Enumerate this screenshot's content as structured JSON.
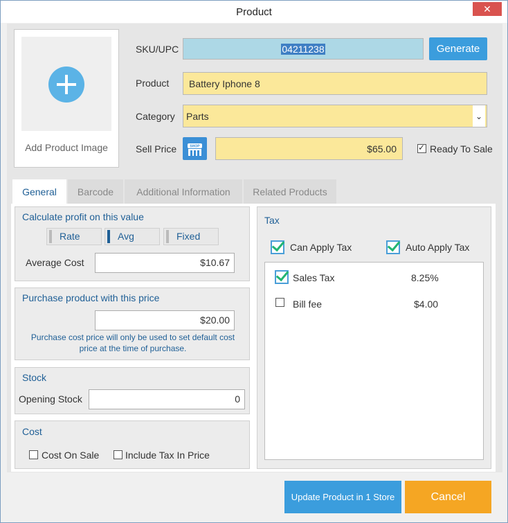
{
  "window": {
    "title": "Product",
    "close_label": "✕"
  },
  "image": {
    "add_label": "Add Product Image"
  },
  "form": {
    "sku_label": "SKU/UPC",
    "sku_value": "04211238",
    "generate_label": "Generate",
    "product_label": "Product",
    "product_value": "Battery Iphone 8",
    "category_label": "Category",
    "category_value": "Parts",
    "sell_price_label": "Sell Price",
    "sell_price_value": "$65.00",
    "shop_icon_text": "SHOP",
    "ready_to_sale_label": "Ready To Sale",
    "ready_to_sale_checked": true
  },
  "tabs": [
    {
      "label": "General",
      "active": true
    },
    {
      "label": "Barcode",
      "active": false
    },
    {
      "label": "Additional Information",
      "active": false
    },
    {
      "label": "Related Products",
      "active": false
    }
  ],
  "profit": {
    "title": "Calculate profit on this value",
    "buttons": [
      {
        "label": "Rate",
        "selected": false
      },
      {
        "label": "Avg",
        "selected": true
      },
      {
        "label": "Fixed",
        "selected": false
      }
    ],
    "average_cost_label": "Average Cost",
    "average_cost_value": "$10.67"
  },
  "purchase": {
    "title": "Purchase product with this price",
    "value": "$20.00",
    "note": "Purchase cost price will only be used to set default cost price at the time of purchase."
  },
  "stock": {
    "title": "Stock",
    "opening_label": "Opening Stock",
    "opening_value": "0"
  },
  "cost": {
    "title": "Cost",
    "cost_on_sale_label": "Cost On Sale",
    "include_tax_label": "Include Tax In Price"
  },
  "tax": {
    "title": "Tax",
    "can_apply_label": "Can Apply Tax",
    "auto_apply_label": "Auto Apply Tax",
    "items": [
      {
        "name": "Sales Tax",
        "value": "8.25%",
        "checked": true
      },
      {
        "name": "Bill fee",
        "value": "$4.00",
        "checked": false
      }
    ]
  },
  "footer": {
    "update_label": "Update Product in 1 Store",
    "cancel_label": "Cancel"
  },
  "colors": {
    "accent_blue": "#3b9ddd",
    "cancel_orange": "#f5a623",
    "field_yellow": "#fbe89a",
    "close_red": "#d9534f"
  }
}
